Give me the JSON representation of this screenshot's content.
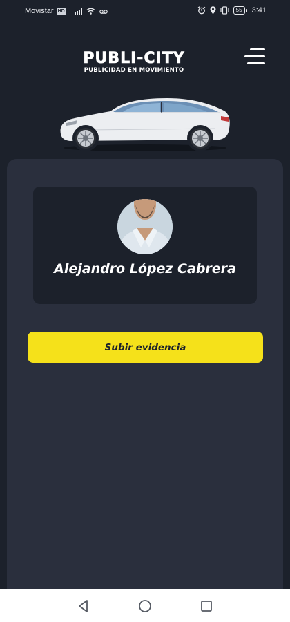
{
  "status_bar": {
    "carrier": "Movistar",
    "network_chip": "HD",
    "battery": "55",
    "time": "3:41"
  },
  "header": {
    "logo_title": "PUBLI-CITY",
    "logo_subtitle": "PUBLICIDAD EN MOVIMIENTO",
    "icons": {
      "menu": "hamburger-menu-icon",
      "car": "car-illustration"
    }
  },
  "profile": {
    "name": "Alejandro López Cabrera"
  },
  "actions": {
    "upload_label": "Subir evidencia"
  },
  "colors": {
    "background": "#1c212b",
    "panel": "#2a2f3d",
    "accent_button": "#f5e11a",
    "nav_bar": "#ffffff"
  }
}
